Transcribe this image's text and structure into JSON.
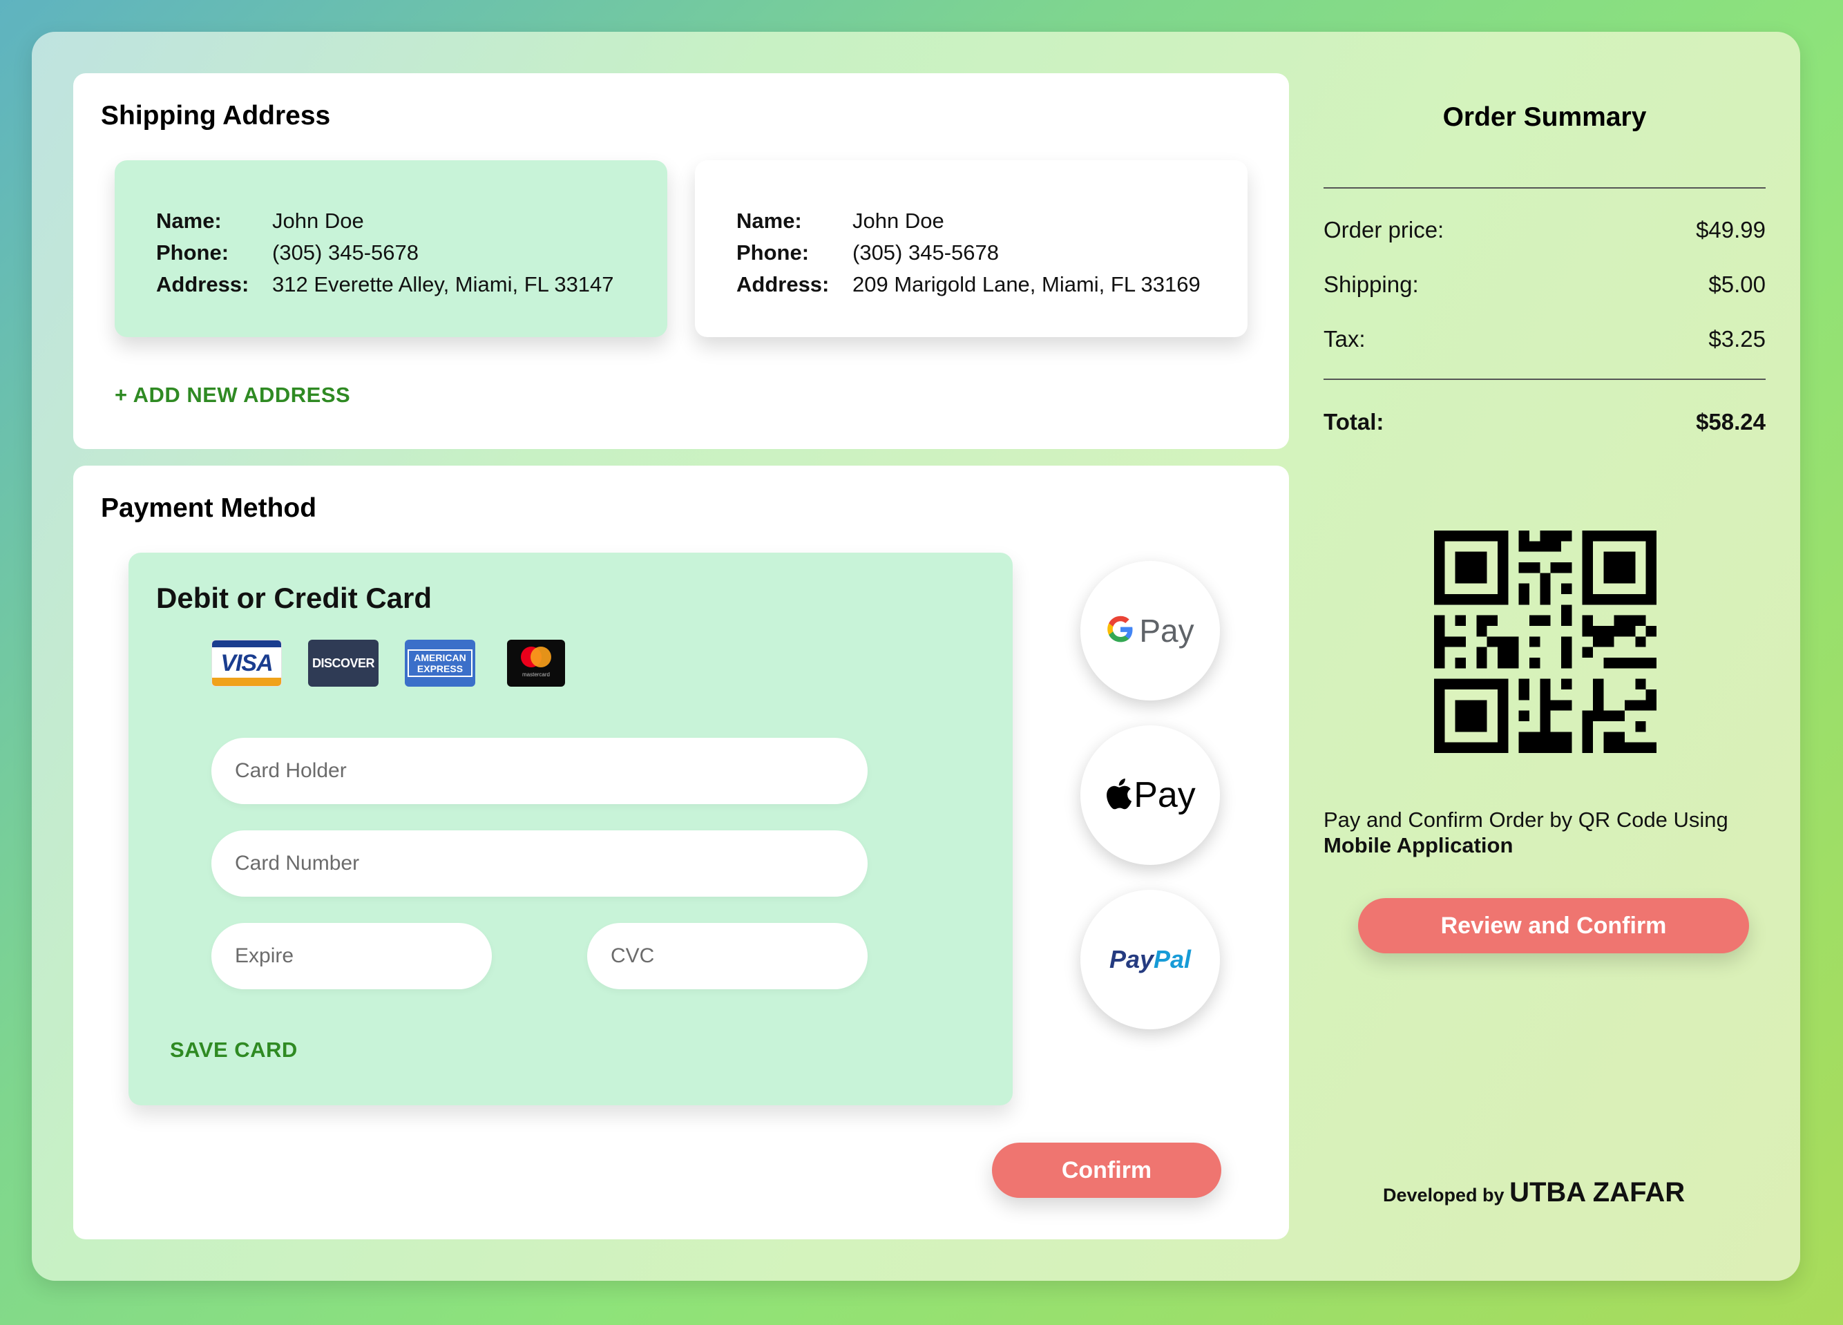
{
  "shipping": {
    "title": "Shipping Address",
    "addresses": [
      {
        "name_label": "Name:",
        "name": "John Doe",
        "phone_label": "Phone:",
        "phone": "(305) 345-5678",
        "address_label": "Address:",
        "address": "312 Everette Alley, Miami, FL 33147",
        "selected": true
      },
      {
        "name_label": "Name:",
        "name": "John Doe",
        "phone_label": "Phone:",
        "phone": "(305) 345-5678",
        "address_label": "Address:",
        "address": "209 Marigold Lane, Miami, FL 33169",
        "selected": false
      }
    ],
    "add_new": "+ ADD NEW ADDRESS"
  },
  "payment": {
    "title": "Payment Method",
    "card_section_title": "Debit or Credit Card",
    "brands": {
      "visa": "VISA",
      "discover": "DISCOVER",
      "amex": "AMERICAN EXPRESS",
      "mastercard": "mastercard"
    },
    "fields": {
      "card_holder": "Card Holder",
      "card_number": "Card Number",
      "expire": "Expire",
      "cvc": "CVC"
    },
    "save_card": "SAVE CARD",
    "wallets": {
      "gpay_text": "Pay",
      "applepay_text": "Pay",
      "paypal_a": "Pay",
      "paypal_b": "Pal"
    },
    "confirm": "Confirm"
  },
  "summary": {
    "title": "Order Summary",
    "rows": [
      {
        "label": "Order price:",
        "value": "$49.99"
      },
      {
        "label": "Shipping:",
        "value": "$5.00"
      },
      {
        "label": "Tax:",
        "value": "$3.25"
      }
    ],
    "total_label": "Total:",
    "total_value": "$58.24",
    "qr_text": "Pay and Confirm Order by QR Code Using",
    "qr_text_bold": "Mobile Application",
    "review_button": "Review and Confirm"
  },
  "credit": {
    "prefix": "Developed by",
    "name": "UTBA ZAFAR"
  },
  "colors": {
    "accent_green": "#2f8a23",
    "selected_card": "#c8f3d8",
    "button": "#ef7570"
  }
}
